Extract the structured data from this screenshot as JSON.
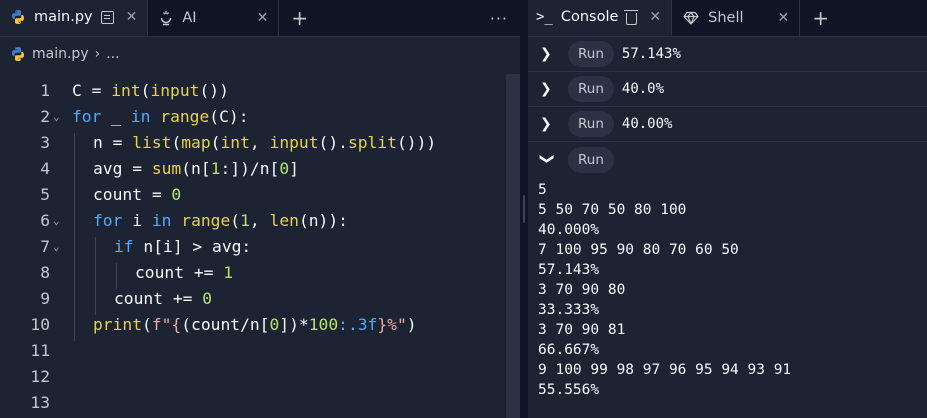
{
  "editor": {
    "tabs": [
      {
        "label": "main.py",
        "active": true,
        "icon": "python-icon"
      },
      {
        "label": "AI",
        "active": false,
        "icon": "ai-icon"
      }
    ],
    "breadcrumb": {
      "file": "main.py",
      "sep": "›",
      "rest": "..."
    },
    "lines": [
      {
        "n": "1",
        "fold": ""
      },
      {
        "n": "2",
        "fold": "⌄"
      },
      {
        "n": "3",
        "fold": ""
      },
      {
        "n": "4",
        "fold": ""
      },
      {
        "n": "5",
        "fold": ""
      },
      {
        "n": "6",
        "fold": "⌄"
      },
      {
        "n": "7",
        "fold": "⌄"
      },
      {
        "n": "8",
        "fold": ""
      },
      {
        "n": "9",
        "fold": ""
      },
      {
        "n": "10",
        "fold": ""
      },
      {
        "n": "11",
        "fold": ""
      },
      {
        "n": "12",
        "fold": ""
      },
      {
        "n": "13",
        "fold": ""
      }
    ],
    "code": {
      "l1": [
        "C = ",
        "int",
        "(",
        "input",
        "())"
      ],
      "l2": [
        "for",
        " _ ",
        "in",
        " ",
        "range",
        "(C):"
      ],
      "l3": [
        "n = ",
        "list",
        "(",
        "map",
        "(",
        "int",
        ", ",
        "input",
        "().",
        "split",
        "()))"
      ],
      "l4": [
        "avg = ",
        "sum",
        "(n[",
        "1",
        ":])/n[",
        "0",
        "]"
      ],
      "l5": [
        "count = ",
        "0"
      ],
      "l6": [
        "for",
        " i ",
        "in",
        " ",
        "range",
        "(",
        "1",
        ", ",
        "len",
        "(n)):"
      ],
      "l7": [
        "if",
        " n[i] > avg:"
      ],
      "l8": [
        "count += ",
        "1"
      ],
      "l9": [
        "count += ",
        "0"
      ],
      "l10": [
        "print",
        "(",
        "f\"{",
        "(count/n[",
        "0",
        "])*",
        "100",
        ":.3f",
        "}%\"",
        ")"
      ]
    }
  },
  "console": {
    "tabs": [
      {
        "label": "Console",
        "active": true
      },
      {
        "label": "Shell",
        "active": false
      }
    ],
    "runs": [
      {
        "label": "Run",
        "result": "57.143%",
        "expanded": false
      },
      {
        "label": "Run",
        "result": "40.0%",
        "expanded": false
      },
      {
        "label": "Run",
        "result": "40.00%",
        "expanded": false
      },
      {
        "label": "Run",
        "result": "",
        "expanded": true
      }
    ],
    "output": [
      "5",
      "5 50 70 50 80 100",
      "40.000%",
      "7 100 95 90 80 70 60 50",
      "57.143%",
      "3 70 90 80",
      "33.333%",
      "3 70 90 81",
      "66.667%",
      "9 100 99 98 97 96 95 94 93 91",
      "55.556%"
    ]
  }
}
